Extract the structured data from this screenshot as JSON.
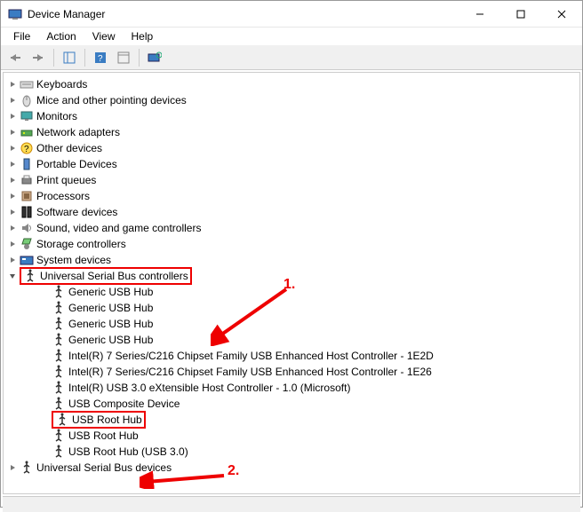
{
  "window": {
    "title": "Device Manager"
  },
  "menu": {
    "file": "File",
    "action": "Action",
    "view": "View",
    "help": "Help"
  },
  "categories": [
    {
      "name": "Keyboards",
      "icon": "keyboard"
    },
    {
      "name": "Mice and other pointing devices",
      "icon": "mouse"
    },
    {
      "name": "Monitors",
      "icon": "monitor"
    },
    {
      "name": "Network adapters",
      "icon": "network"
    },
    {
      "name": "Other devices",
      "icon": "other"
    },
    {
      "name": "Portable Devices",
      "icon": "portable"
    },
    {
      "name": "Print queues",
      "icon": "printer"
    },
    {
      "name": "Processors",
      "icon": "cpu"
    },
    {
      "name": "Software devices",
      "icon": "software"
    },
    {
      "name": "Sound, video and game controllers",
      "icon": "sound"
    },
    {
      "name": "Storage controllers",
      "icon": "storage"
    },
    {
      "name": "System devices",
      "icon": "system"
    }
  ],
  "usbCategory": {
    "name": "Universal Serial Bus controllers",
    "icon": "usb"
  },
  "usbDevices": [
    "Generic USB Hub",
    "Generic USB Hub",
    "Generic USB Hub",
    "Generic USB Hub",
    "Intel(R) 7 Series/C216 Chipset Family USB Enhanced Host Controller - 1E2D",
    "Intel(R) 7 Series/C216 Chipset Family USB Enhanced Host Controller - 1E26",
    "Intel(R) USB 3.0 eXtensible Host Controller - 1.0 (Microsoft)",
    "USB Composite Device",
    "USB Root Hub",
    "USB Root Hub",
    "USB Root Hub (USB 3.0)"
  ],
  "usbBusDevices": {
    "name": "Universal Serial Bus devices",
    "icon": "usb"
  },
  "annotations": {
    "a1": "1.",
    "a2": "2."
  }
}
